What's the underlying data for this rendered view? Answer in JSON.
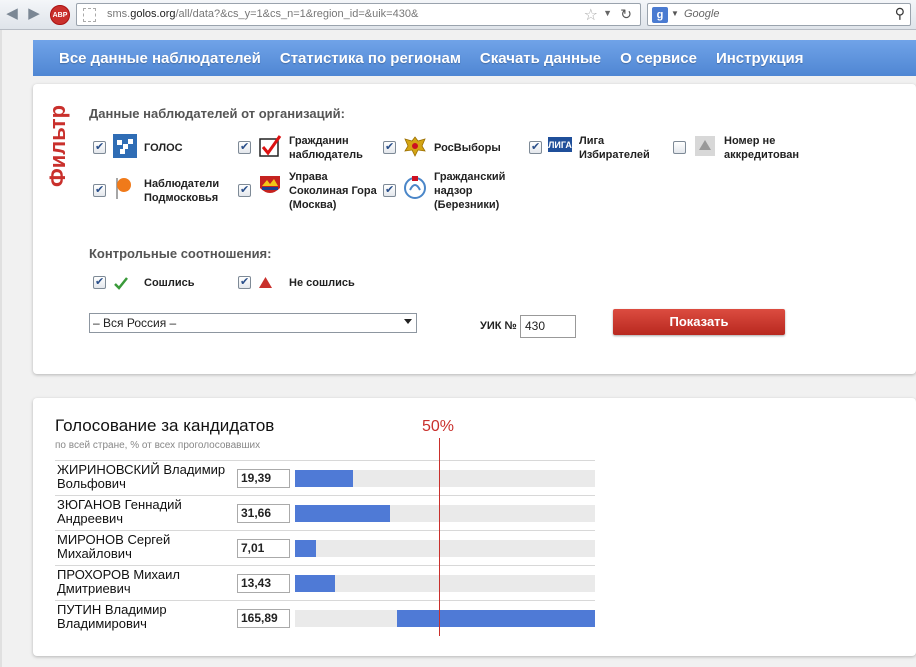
{
  "browser": {
    "url_prefix": "sms.",
    "url_domain": "golos.org",
    "url_rest": "/all/data?&cs_y=1&cs_n=1&region_id=&uik=430&",
    "search_placeholder": "Google",
    "adblock_label": "ABP"
  },
  "nav": {
    "items": [
      {
        "label": "Все данные наблюдателей"
      },
      {
        "label": "Статистика по регионам"
      },
      {
        "label": "Скачать данные"
      },
      {
        "label": "О сервисе"
      },
      {
        "label": "Инструкция"
      }
    ]
  },
  "filter": {
    "vertical_title": "Фильтр",
    "orgs_label": "Данные наблюдателей от организаций:",
    "orgs": [
      {
        "label": "ГОЛОС",
        "checked": true,
        "icon": "golos-logo-icon"
      },
      {
        "label": "Гражданин\nнаблюдатель",
        "checked": true,
        "icon": "citizen-observer-logo-icon"
      },
      {
        "label": "РосВыборы",
        "checked": true,
        "icon": "rosvybory-eagle-icon"
      },
      {
        "label": "Лига\nИзбирателей",
        "checked": true,
        "icon": "liga-logo-icon"
      },
      {
        "label": "Номер не\nаккредитован",
        "checked": false,
        "icon": "not-accredited-icon"
      },
      {
        "label": "Наблюдатели\nПодмосковья",
        "checked": true,
        "icon": "orange-flag-icon"
      },
      {
        "label": "Управа\nСоколиная Гора\n(Москва)",
        "checked": true,
        "icon": "sokolinaya-gora-emblem-icon"
      },
      {
        "label": "Гражданский\nнадзор\n(Березники)",
        "checked": true,
        "icon": "civil-oversight-logo-icon"
      }
    ],
    "control_label": "Контрольные соотношения:",
    "control": [
      {
        "label": "Сошлись",
        "checked": true,
        "icon": "green-check-icon"
      },
      {
        "label": "Не сошлись",
        "checked": true,
        "icon": "red-warning-icon"
      }
    ],
    "region_value": "– Вся Россия –",
    "uik_label": "УИК №",
    "uik_value": "430",
    "show_button": "Показать"
  },
  "results": {
    "title": "Голосование за кандидатов",
    "subtitle": "по всей стране, % от всех проголосовавших",
    "marker_label": "50%",
    "candidates": [
      {
        "name": "ЖИРИНОВСКИЙ Владимир Вольфович",
        "value": "19,39",
        "pct": 19.39
      },
      {
        "name": "ЗЮГАНОВ Геннадий Андреевич",
        "value": "31,66",
        "pct": 31.66
      },
      {
        "name": "МИРОНОВ Сергей Михайлович",
        "value": "7,01",
        "pct": 7.01
      },
      {
        "name": "ПРОХОРОВ Михаил Дмитриевич",
        "value": "13,43",
        "pct": 13.43
      },
      {
        "name": "ПУТИН Владимир Владимирович",
        "value": "165,89",
        "pct": 165.89
      }
    ]
  },
  "colors": {
    "accent_red": "#c9302c",
    "nav_blue": "#5a8fda",
    "bar_blue": "#4f7ad6"
  }
}
